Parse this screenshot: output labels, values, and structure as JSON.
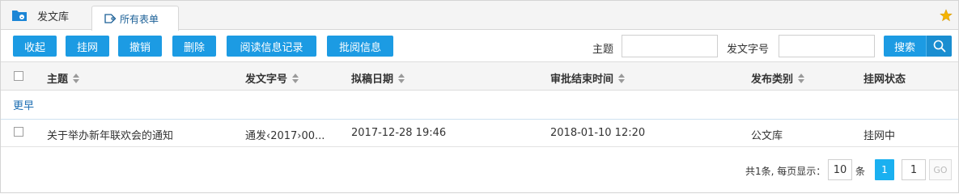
{
  "tabs": {
    "home_label": "发文库",
    "active_label": "所有表单"
  },
  "toolbar": {
    "buttons": [
      "收起",
      "挂网",
      "撤销",
      "删除",
      "阅读信息记录",
      "批阅信息"
    ],
    "subject_label": "主题",
    "subject_value": "",
    "doc_no_label": "发文字号",
    "doc_no_value": "",
    "search_label": "搜索"
  },
  "table": {
    "columns": [
      "主题",
      "发文字号",
      "拟稿日期",
      "审批结束时间",
      "发布类别",
      "挂网状态"
    ],
    "group_label": "更早",
    "rows": [
      {
        "subject": "关于举办新年联欢会的通知",
        "doc_no": "通发‹2017›00...",
        "draft_date": "2017-12-28 19:46",
        "approval_end": "2018-01-10 12:20",
        "category": "公文库",
        "status": "挂网中"
      }
    ]
  },
  "pager": {
    "summary": "共1条, 每页显示：",
    "page_size": "10",
    "unit": "条",
    "current_page": "1",
    "goto_value": "1",
    "go_label": "GO"
  },
  "colors": {
    "accent": "#1c9be3",
    "tab_active_text": "#1a5f96",
    "group_label": "#1e6fb3",
    "pager_current": "#1ab0f0",
    "star": "#f5b400"
  }
}
